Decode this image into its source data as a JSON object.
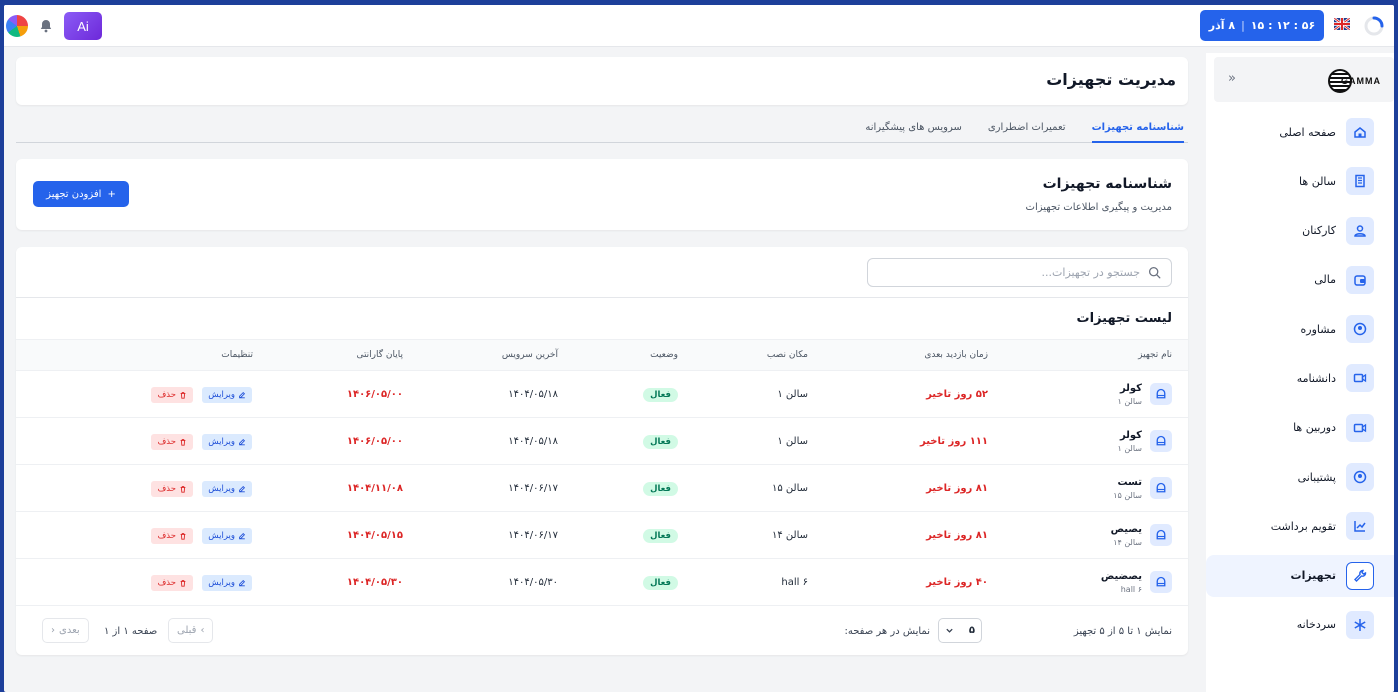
{
  "topbar": {
    "clock": {
      "time": "۵۶ : ۱۲ : ۱۵",
      "date": "۸ آذر"
    },
    "ai_label": "Ai",
    "colors": {
      "clock_bg": "#2563eb",
      "ai_bg": "#7c3aed"
    }
  },
  "sidebar": {
    "logo": "GAMMA",
    "items": [
      {
        "label": "صفحه اصلی",
        "icon": "home-icon"
      },
      {
        "label": "سالن ها",
        "icon": "building-icon"
      },
      {
        "label": "کارکنان",
        "icon": "users-icon"
      },
      {
        "label": "مالی",
        "icon": "wallet-icon"
      },
      {
        "label": "مشاوره",
        "icon": "user-circle-icon"
      },
      {
        "label": "دانشنامه",
        "icon": "video-icon"
      },
      {
        "label": "دوربین ها",
        "icon": "camera-icon"
      },
      {
        "label": "پشتیبانی",
        "icon": "support-icon"
      },
      {
        "label": "تقویم برداشت",
        "icon": "chart-icon"
      },
      {
        "label": "تجهیزات",
        "icon": "wrench-icon",
        "active": true
      },
      {
        "label": "سردخانه",
        "icon": "snowflake-icon"
      }
    ]
  },
  "header": {
    "title": "مدیریت تجهیزات"
  },
  "tabs": [
    {
      "label": "شناسنامه تجهیزات",
      "active": true
    },
    {
      "label": "تعمیرات اضطراری",
      "active": false
    },
    {
      "label": "سرویس های پیشگیرانه",
      "active": false
    }
  ],
  "info": {
    "title": "شناسنامه تجهیزات",
    "subtitle": "مدیریت و پیگیری اطلاعات تجهیزات",
    "add_button": "افزودن تجهیز"
  },
  "list": {
    "search_placeholder": "جستجو در تجهیزات...",
    "title": "لیست تجهیزات",
    "columns": {
      "name": "نام تجهیز",
      "next_visit": "زمان بازدید بعدی",
      "location": "مکان نصب",
      "status": "وضعیت",
      "last_service": "آخرین سرویس",
      "warranty_end": "پایان گارانتی",
      "settings": "تنظیمات"
    },
    "edit_label": "ویرایش",
    "delete_label": "حذف",
    "rows": [
      {
        "name": "کولر",
        "sub": "سالن ۱",
        "next_visit": "۵۲ روز تاخیر",
        "location": "سالن ۱",
        "status": "فعال",
        "last_service": "۱۴۰۴/۰۵/۱۸",
        "warranty_end": "۱۴۰۶/۰۵/۰۰"
      },
      {
        "name": "کولر",
        "sub": "سالن ۱",
        "next_visit": "۱۱۱ روز تاخیر",
        "location": "سالن ۱",
        "status": "فعال",
        "last_service": "۱۴۰۴/۰۵/۱۸",
        "warranty_end": "۱۴۰۶/۰۵/۰۰"
      },
      {
        "name": "تست",
        "sub": "سالن ۱۵",
        "next_visit": "۸۱ روز تاخیر",
        "location": "سالن ۱۵",
        "status": "فعال",
        "last_service": "۱۴۰۴/۰۶/۱۷",
        "warranty_end": "۱۴۰۴/۱۱/۰۸"
      },
      {
        "name": "یصیص",
        "sub": "سالن ۱۴",
        "next_visit": "۸۱ روز تاخیر",
        "location": "سالن ۱۴",
        "status": "فعال",
        "last_service": "۱۴۰۴/۰۶/۱۷",
        "warranty_end": "۱۴۰۴/۰۵/۱۵"
      },
      {
        "name": "یصضیض",
        "sub": "hall ۶",
        "next_visit": "۴۰ روز تاخیر",
        "location": "hall ۶",
        "status": "فعال",
        "last_service": "۱۴۰۴/۰۵/۳۰",
        "warranty_end": "۱۴۰۴/۰۵/۳۰"
      }
    ]
  },
  "pagination": {
    "summary": "نمایش ۱ تا ۵ از ۵ تجهیز",
    "per_page_label": "نمایش در هر صفحه:",
    "per_page_value": "۵",
    "page_info": "صفحه ۱ از ۱",
    "prev_label": "قبلی",
    "next_label": "بعدی"
  }
}
